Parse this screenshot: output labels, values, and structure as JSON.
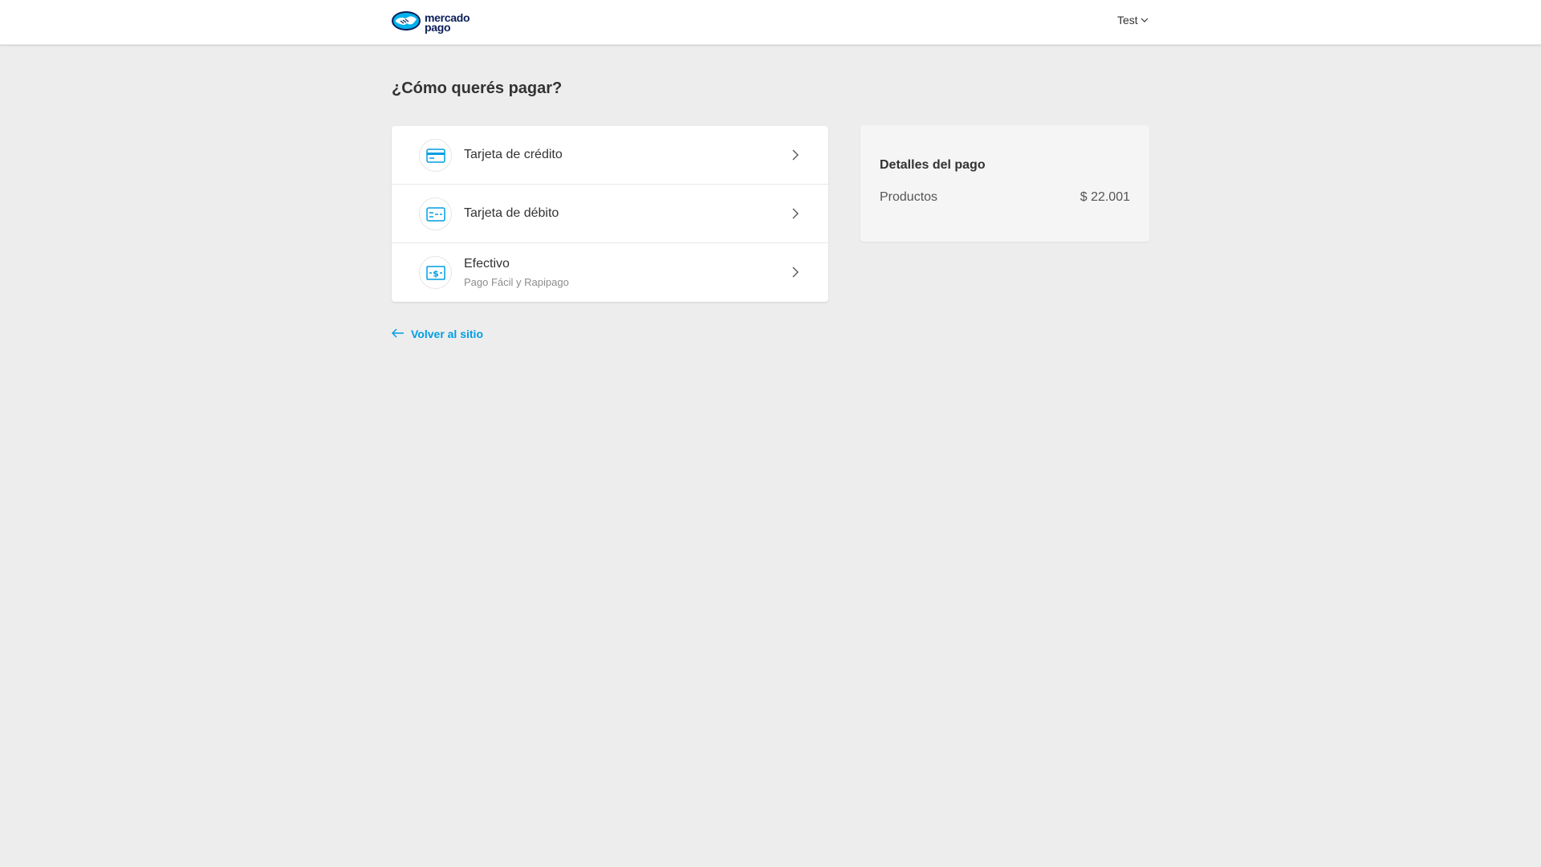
{
  "header": {
    "logo": {
      "line1": "mercado",
      "line2": "pago",
      "icon": "handshake-logo-icon"
    },
    "user_menu": {
      "label": "Test",
      "icon": "chevron-down-icon"
    }
  },
  "main": {
    "title": "¿Cómo querés pagar?",
    "methods": [
      {
        "title": "Tarjeta de crédito",
        "subtitle": "",
        "icon": "credit-card-icon"
      },
      {
        "title": "Tarjeta de débito",
        "subtitle": "",
        "icon": "debit-card-icon"
      },
      {
        "title": "Efectivo",
        "subtitle": "Pago Fácil y Rapipago",
        "icon": "cash-icon"
      }
    ],
    "back_link": {
      "label": "Volver al sitio",
      "icon": "arrow-left-icon"
    }
  },
  "summary": {
    "title": "Detalles del pago",
    "rows": [
      {
        "label": "Productos",
        "value": "$ 22.001"
      }
    ]
  },
  "colors": {
    "accent": "#009ee3",
    "brand_dark": "#0c1e5b",
    "background": "#ededed"
  }
}
